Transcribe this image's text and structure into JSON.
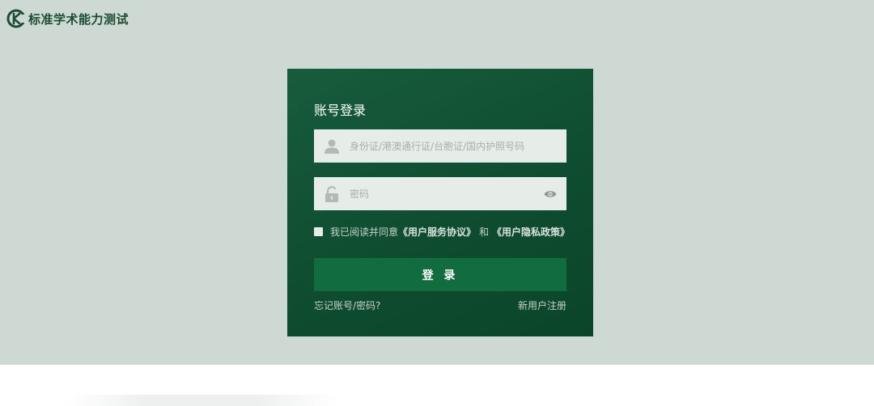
{
  "app": {
    "title": "标准学术能力测试",
    "logo_icon": "ck-logo-icon"
  },
  "login": {
    "title": "账号登录",
    "id_field": {
      "value": "",
      "placeholder": "身份证/港澳通行证/台胞证/国内护照号码",
      "icon": "user-icon"
    },
    "password_field": {
      "value": "",
      "placeholder": "密码",
      "icon": "lock-icon",
      "toggle_icon": "eye-icon"
    },
    "agreement": {
      "prefix": "我已阅读并同意",
      "user_agreement": "《用户服务协议》",
      "connector": "和",
      "privacy_policy": "《用户隐私政策》",
      "checked": false
    },
    "submit_label": "登 录",
    "forgot_link": "忘记账号/密码?",
    "register_link": "新用户注册"
  },
  "colors": {
    "background": "#cdd9d2",
    "card": "#12553a",
    "button": "#116d3f",
    "brand_text": "#1b4d34"
  }
}
